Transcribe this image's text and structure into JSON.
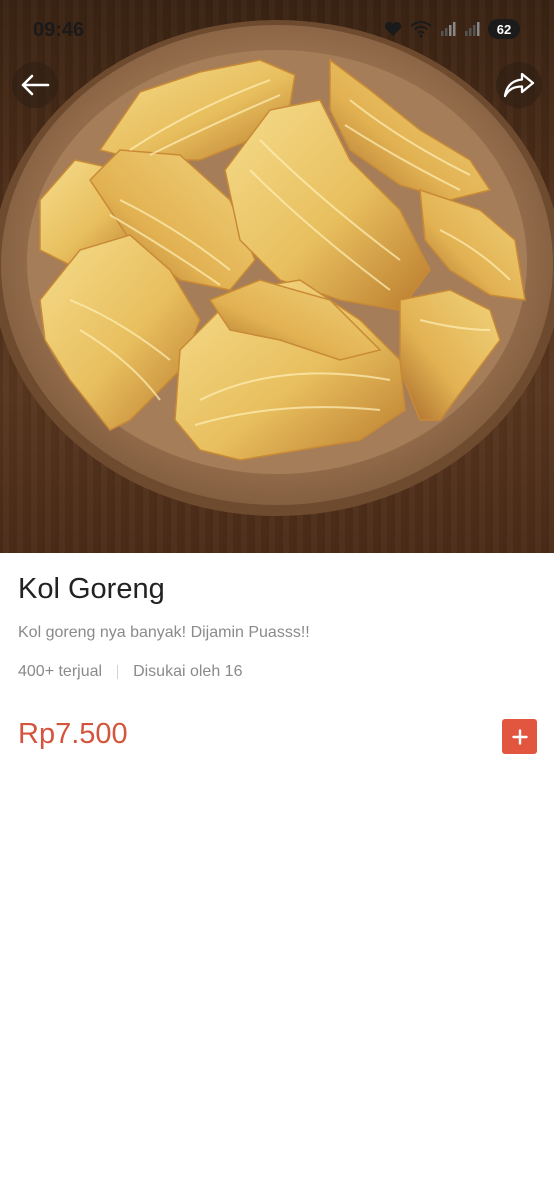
{
  "status_bar": {
    "time": "09:46",
    "battery": "62",
    "icons": [
      "heart-icon",
      "wifi-icon",
      "signal-icon",
      "signal-icon",
      "battery-icon"
    ]
  },
  "nav": {
    "back_icon": "arrow-left-icon",
    "share_icon": "share-icon"
  },
  "product": {
    "name": "Kol Goreng",
    "description": "Kol goreng nya banyak! Dijamin Puasss!!",
    "sold": "400+ terjual",
    "liked": "Disukai oleh 16",
    "price": "Rp7.500",
    "add_icon": "plus-icon"
  },
  "colors": {
    "price": "#d4553d",
    "add_button": "#e2553e",
    "muted_text": "#8a8a8a",
    "title_text": "#222222"
  }
}
